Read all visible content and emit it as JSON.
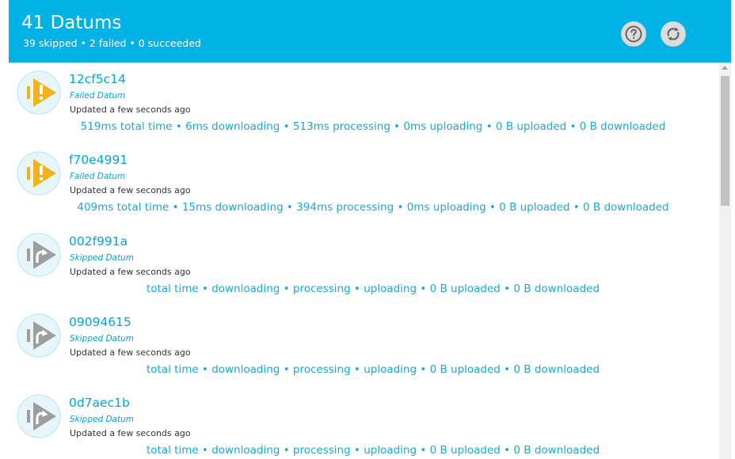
{
  "header": {
    "title": "41 Datums",
    "subtitle": "39 skipped • 2 failed • 0 succeeded",
    "help_icon": "help-circle-icon",
    "refresh_icon": "refresh-icon"
  },
  "colors": {
    "header_bg": "#00b2e5",
    "accent": "#00a6dc",
    "failed": "#f2b21a",
    "skipped": "#9e9e9e",
    "icon_bg": "#e6f6fc"
  },
  "datums": [
    {
      "id": "12cf5c14",
      "state": "Failed Datum",
      "status": "failed",
      "updated": "Updated a few seconds ago",
      "stats": "519ms total time • 6ms downloading • 513ms processing • 0ms uploading • 0 B uploaded • 0 B downloaded"
    },
    {
      "id": "f70e4991",
      "state": "Failed Datum",
      "status": "failed",
      "updated": "Updated a few seconds ago",
      "stats": "409ms total time • 15ms downloading • 394ms processing • 0ms uploading • 0 B uploaded • 0 B downloaded"
    },
    {
      "id": "002f991a",
      "state": "Skipped Datum",
      "status": "skipped",
      "updated": "Updated a few seconds ago",
      "stats": "total time • downloading • processing • uploading • 0 B uploaded • 0 B downloaded"
    },
    {
      "id": "09094615",
      "state": "Skipped Datum",
      "status": "skipped",
      "updated": "Updated a few seconds ago",
      "stats": "total time • downloading • processing • uploading • 0 B uploaded • 0 B downloaded"
    },
    {
      "id": "0d7aec1b",
      "state": "Skipped Datum",
      "status": "skipped",
      "updated": "Updated a few seconds ago",
      "stats": "total time • downloading • processing • uploading • 0 B uploaded • 0 B downloaded"
    }
  ]
}
